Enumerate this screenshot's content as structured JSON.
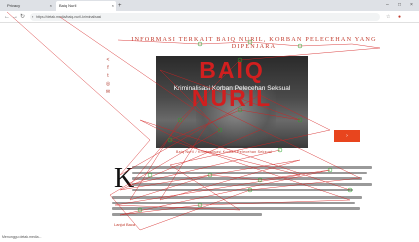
{
  "browser": {
    "tabs": [
      {
        "label": "Privacy"
      },
      {
        "label": "Baiq Nuril"
      }
    ],
    "new_tab": "+",
    "window_controls": [
      "–",
      "□",
      "×"
    ],
    "url": "https://detak.media/baiq-nuril-kriminalisasi",
    "right_icons": [
      "☆",
      "●"
    ]
  },
  "article": {
    "headline": "Informasi Terkait Baiq Nuril, Korban Pelecehan yang Dipenjara",
    "social_icons": [
      "share-icon",
      "facebook-icon",
      "twitter-icon",
      "whatsapp-icon",
      "email-icon"
    ],
    "hero_title": "BAIQ NURIL",
    "hero_subtitle": "Kriminalisasi Korban Pelecehan Seksual",
    "orange_button": "›",
    "image_caption": "Baiq Nuril / Kriminalisasi Korban Pelecehan Seksual",
    "dropcap": "K",
    "more_link": "Lanjut Baca"
  },
  "status_text": "Menunggu detak.media..."
}
